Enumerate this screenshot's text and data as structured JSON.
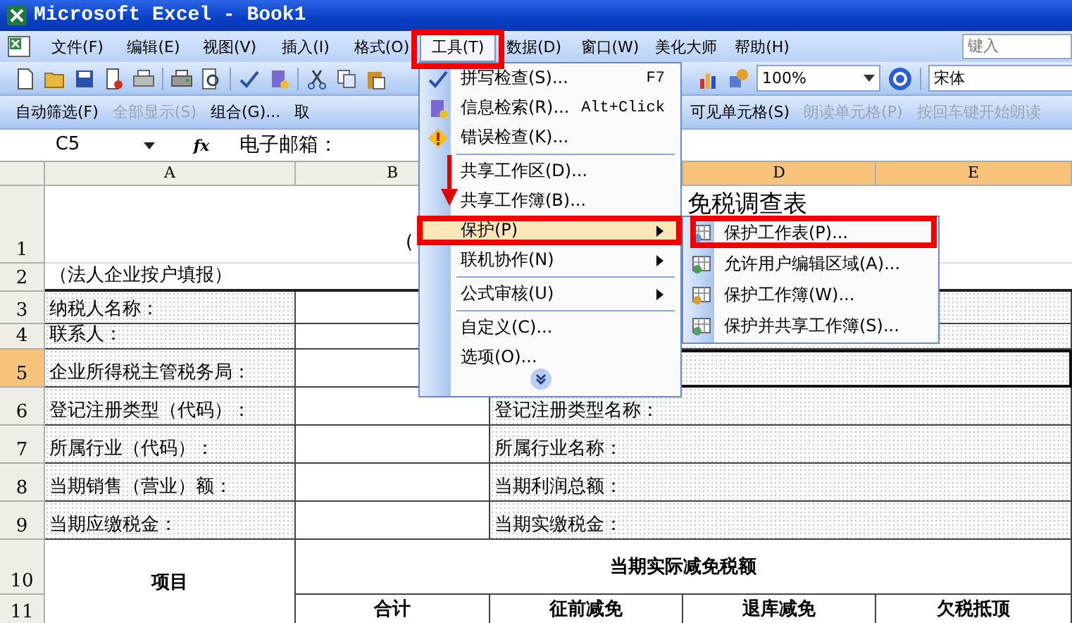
{
  "window": {
    "title": "Microsoft Excel - Book1"
  },
  "menu_bar": {
    "items": [
      {
        "label": "文件(F)",
        "selected": false
      },
      {
        "label": "编辑(E)",
        "selected": false
      },
      {
        "label": "视图(V)",
        "selected": false
      },
      {
        "label": "插入(I)",
        "selected": false
      },
      {
        "label": "格式(O)",
        "selected": false
      },
      {
        "label": "工具(T)",
        "selected": true
      },
      {
        "label": "数据(D)",
        "selected": false
      },
      {
        "label": "窗口(W)",
        "selected": false
      },
      {
        "label": "美化大师",
        "selected": false
      },
      {
        "label": "帮助(H)",
        "selected": false
      }
    ],
    "help_search": {
      "placeholder": "键入"
    }
  },
  "standard_toolbar": {
    "zoom": "100%",
    "font": "宋体"
  },
  "list_toolbar": {
    "left_items": [
      {
        "label": "自动筛选(F)",
        "disabled": false
      },
      {
        "label": "全部显示(S)",
        "disabled": true
      },
      {
        "label": "组合(G)...",
        "disabled": false
      },
      {
        "label": "取",
        "disabled": false
      }
    ],
    "right_items": [
      {
        "label": "可见单元格(S)",
        "disabled": false
      },
      {
        "label": "朗读单元格(P)",
        "disabled": true
      },
      {
        "label": "按回车键开始朗读",
        "disabled": true
      }
    ]
  },
  "formula_bar": {
    "name_box": "C5",
    "fx": "fx",
    "content": "电子邮箱："
  },
  "sheet": {
    "columns": [
      {
        "label": "A",
        "selected": false
      },
      {
        "label": "B",
        "selected": false
      },
      {
        "label": "D",
        "selected": true
      },
      {
        "label": "E",
        "selected": true
      }
    ],
    "rows": [
      {
        "label": "1",
        "selected": false
      },
      {
        "label": "2",
        "selected": false
      },
      {
        "label": "3",
        "selected": false
      },
      {
        "label": "4",
        "selected": false
      },
      {
        "label": "5",
        "selected": true
      },
      {
        "label": "6",
        "selected": false
      },
      {
        "label": "7",
        "selected": false
      },
      {
        "label": "8",
        "selected": false
      },
      {
        "label": "9",
        "selected": false
      },
      {
        "label": "10",
        "selected": false
      },
      {
        "label": "11",
        "selected": false
      }
    ],
    "paren": "(",
    "title": "免税调查表",
    "note": "（法人企业按户填报）",
    "left_labels": [
      "纳税人名称：",
      "联系人：",
      "企业所得税主管税务局：",
      "登记注册类型（代码）：",
      "所属行业（代码）：",
      "当期销售（营业）额：",
      "当期应缴税金："
    ],
    "right_labels": [
      "登记注册类型名称：",
      "所属行业名称：",
      "当期利润总额：",
      "当期实缴税金："
    ],
    "item_header": "项目",
    "group_header": "当期实际减免税额",
    "sub_headers": [
      "合计",
      "征前减免",
      "退库减免",
      "欠税抵顶"
    ]
  },
  "tools_menu": {
    "sections": [
      [
        {
          "label": "拼写检查(S)...",
          "shortcut": "F7",
          "submenu": false,
          "selected": false
        },
        {
          "label": "信息检索(R)...",
          "shortcut": "Alt+Click",
          "submenu": false,
          "selected": false
        },
        {
          "label": "错误检查(K)...",
          "submenu": false,
          "selected": false
        }
      ],
      [
        {
          "label": "共享工作区(D)...",
          "submenu": false,
          "selected": false
        },
        {
          "label": "共享工作簿(B)...",
          "submenu": false,
          "selected": false
        },
        {
          "label": "保护(P)",
          "submenu": true,
          "selected": true
        },
        {
          "label": "联机协作(N)",
          "submenu": true,
          "selected": false
        }
      ],
      [
        {
          "label": "公式审核(U)",
          "submenu": true,
          "selected": false
        }
      ],
      [
        {
          "label": "自定义(C)...",
          "submenu": false,
          "selected": false
        },
        {
          "label": "选项(O)...",
          "submenu": false,
          "selected": false
        }
      ]
    ]
  },
  "protect_submenu": {
    "items": [
      {
        "label": "保护工作表(P)...",
        "selected": false
      },
      {
        "label": "允许用户编辑区域(A)...",
        "selected": false
      },
      {
        "label": "保护工作簿(W)...",
        "selected": false
      },
      {
        "label": "保护并共享工作簿(S)...",
        "selected": false
      }
    ]
  }
}
